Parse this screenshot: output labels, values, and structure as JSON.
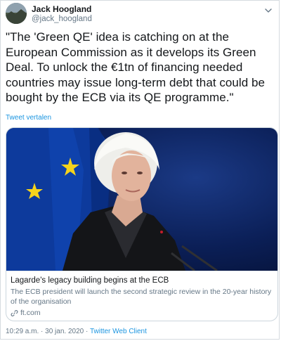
{
  "author": {
    "name": "Jack Hoogland",
    "handle": "@jack_hoogland"
  },
  "tweet": {
    "text": "\"The 'Green QE' idea is catching on at the European Commission as it develops its Green Deal. To unlock the €1tn of financing needed countries may issue long-term debt that could be bought by the ECB via its QE programme.\"",
    "translate_label": "Tweet vertalen"
  },
  "card": {
    "title": "Lagarde's legacy building begins at the ECB",
    "description": "The ECB president will launch the second strategic review in the 20-year history of the organisation",
    "domain": "ft.com",
    "domain_icon": "link-icon"
  },
  "meta": {
    "time": "10:29 a.m.",
    "separator": " · ",
    "date": "30 jan. 2020",
    "separator2": " · ",
    "source": "Twitter Web Client"
  },
  "colors": {
    "link": "#1b95e0",
    "secondary_text": "#657786",
    "eu_flag_blue": "#0d3a9c",
    "eu_star_yellow": "#f5d31c"
  },
  "icons": {
    "menu": "chevron-down-icon",
    "avatar": "avatar-image"
  }
}
